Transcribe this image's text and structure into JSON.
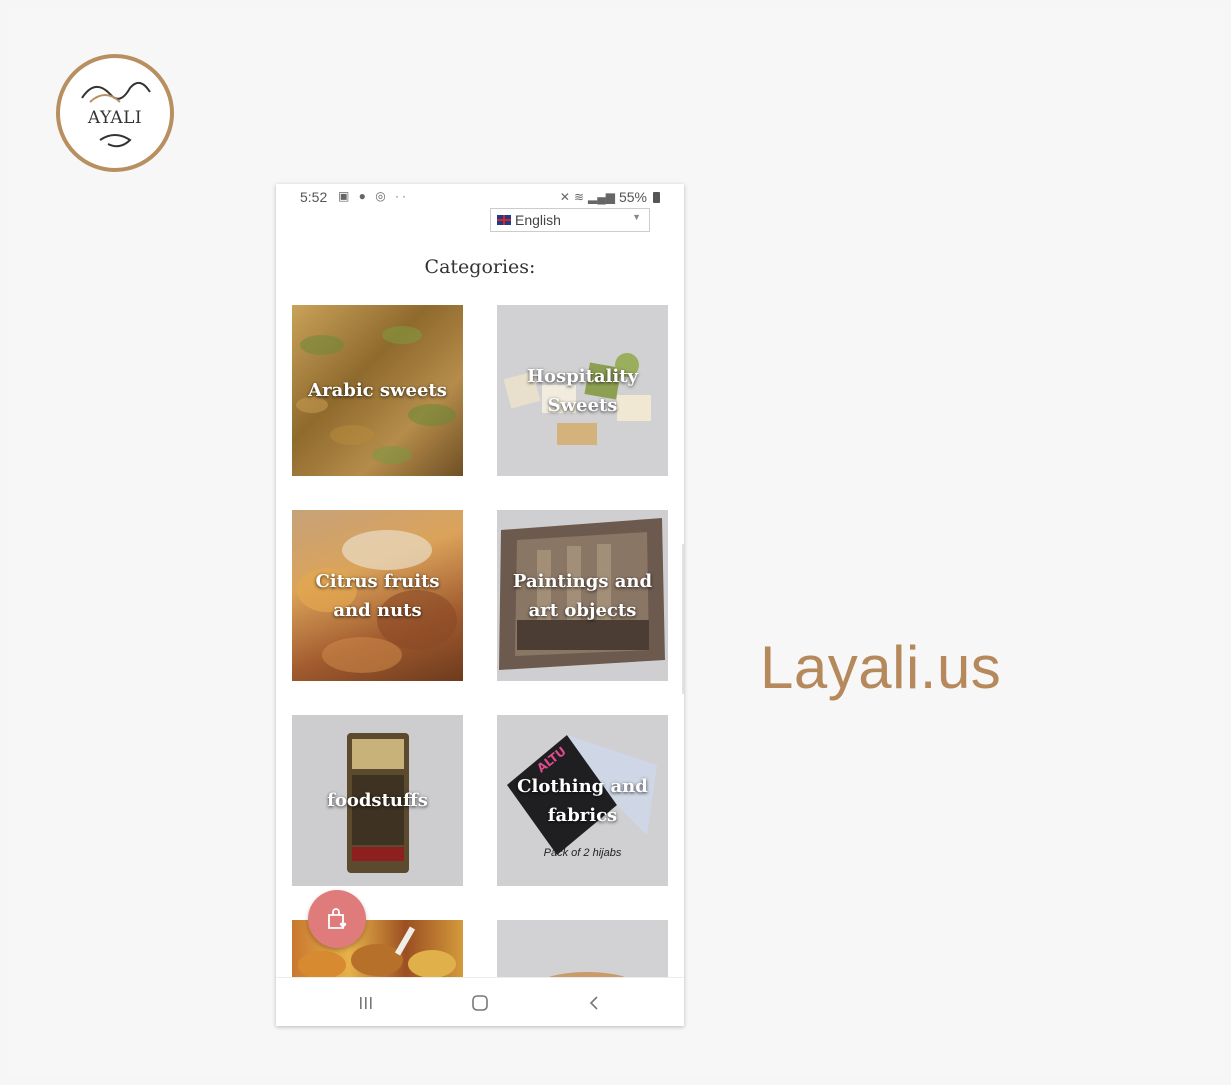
{
  "logo": {
    "text": "AYALI"
  },
  "brand": {
    "name": "Layali.us"
  },
  "statusbar": {
    "time": "5:52",
    "left_icons": "▣ ● ◎ ··",
    "battery": "55%"
  },
  "language": {
    "selected": "English"
  },
  "categories_title": "Categories:",
  "tiles": [
    {
      "label": "Arabic sweets"
    },
    {
      "label": "Hospitality Sweets"
    },
    {
      "label": "Citrus fruits and nuts"
    },
    {
      "label": "Paintings and art objects"
    },
    {
      "label": "foodstuffs"
    },
    {
      "label": "Clothing and fabrics",
      "caption": "Pack of 2 hijabs",
      "package_text": "ALTU"
    },
    {
      "label": ""
    },
    {
      "label": ""
    }
  ],
  "colors": {
    "brand": "#b6895d",
    "fab": "#e07b7b",
    "logo_ring": "#b88f61"
  },
  "icons": {
    "fab": "shopping-bag-heart-icon",
    "nav": [
      "recent-apps-icon",
      "home-icon",
      "back-icon"
    ]
  }
}
